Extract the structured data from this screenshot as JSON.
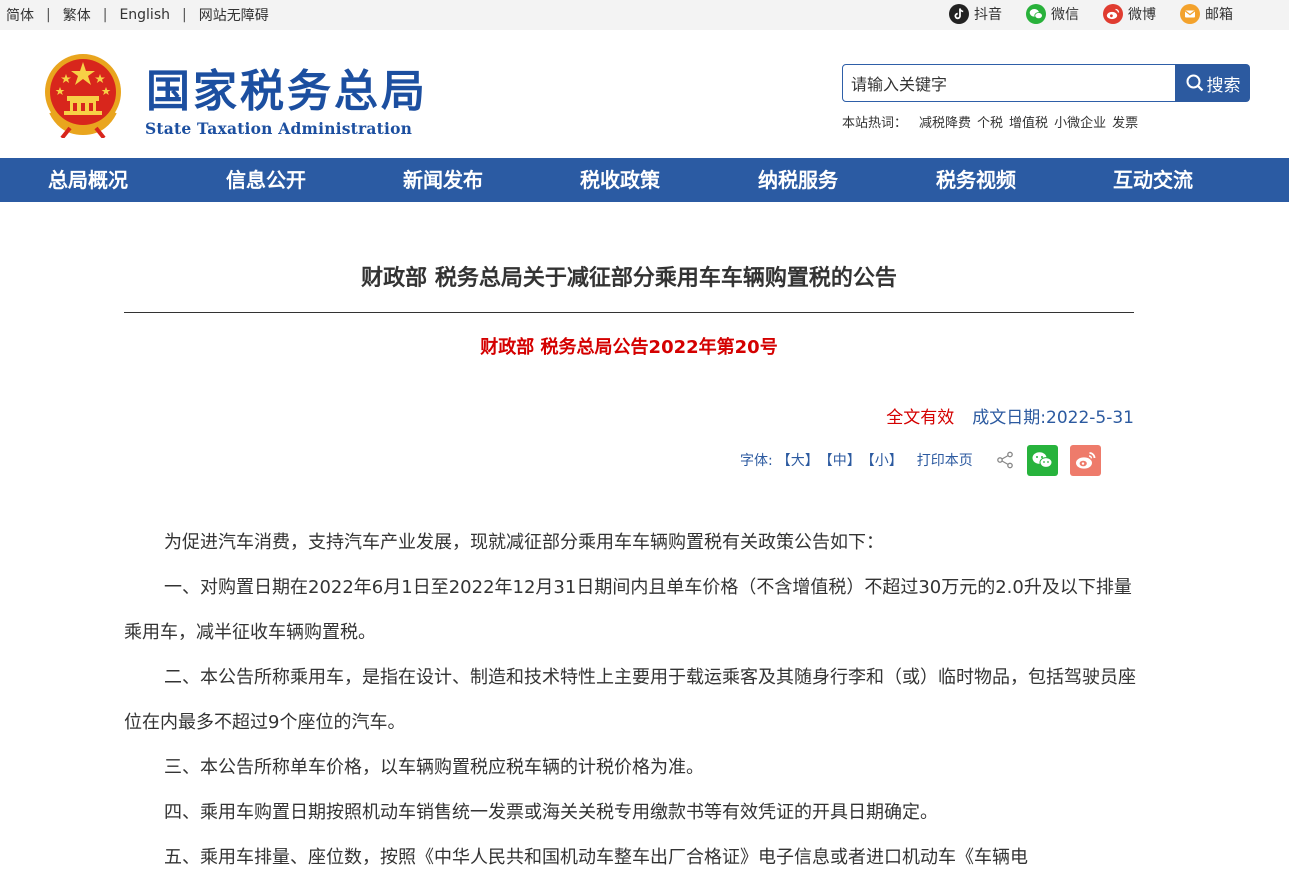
{
  "topbar": {
    "lang_items": [
      "简体",
      "繁体",
      "English",
      "网站无障碍"
    ],
    "separator": "|",
    "social": [
      {
        "label": "抖音",
        "icon": "douyin-icon"
      },
      {
        "label": "微信",
        "icon": "wechat-icon"
      },
      {
        "label": "微博",
        "icon": "weibo-icon"
      },
      {
        "label": "邮箱",
        "icon": "mail-icon"
      }
    ]
  },
  "header": {
    "title_cn": "国家税务总局",
    "title_en": "State Taxation Administration",
    "emblem_icon": "national-emblem-icon",
    "search": {
      "value": "请输入关键字",
      "button_label": "搜索",
      "hot_label": "本站热词：",
      "hot_keywords": [
        "减税降费",
        "个税",
        "增值税",
        "小微企业",
        "发票"
      ]
    }
  },
  "nav": {
    "items": [
      "总局概况",
      "信息公开",
      "新闻发布",
      "税收政策",
      "纳税服务",
      "税务视频",
      "互动交流"
    ]
  },
  "article": {
    "title": "财政部 税务总局关于减征部分乘用车车辆购置税的公告",
    "doc_number": "财政部 税务总局公告2022年第20号",
    "validity": "全文有效",
    "date": "成文日期:2022-5-31",
    "tools": {
      "font_label": "字体:",
      "large": "【大】",
      "medium": "【中】",
      "small": "【小】",
      "print": "打印本页"
    },
    "paragraphs": [
      "为促进汽车消费，支持汽车产业发展，现就减征部分乘用车车辆购置税有关政策公告如下：",
      "一、对购置日期在2022年6月1日至2022年12月31日期间内且单车价格（不含增值税）不超过30万元的2.0升及以下排量乘用车，减半征收车辆购置税。",
      "二、本公告所称乘用车，是指在设计、制造和技术特性上主要用于载运乘客及其随身行李和（或）临时物品，包括驾驶员座位在内最多不超过9个座位的汽车。",
      "三、本公告所称单车价格，以车辆购置税应税车辆的计税价格为准。",
      "四、乘用车购置日期按照机动车销售统一发票或海关关税专用缴款书等有效凭证的开具日期确定。",
      "五、乘用车排量、座位数，按照《中华人民共和国机动车整车出厂合格证》电子信息或者进口机动车《车辆电"
    ]
  },
  "colors": {
    "brand_blue": "#2b5ba3",
    "title_blue": "#1c4fa0",
    "accent_red": "#d40000",
    "topbar_bg": "#f3f3f3"
  }
}
